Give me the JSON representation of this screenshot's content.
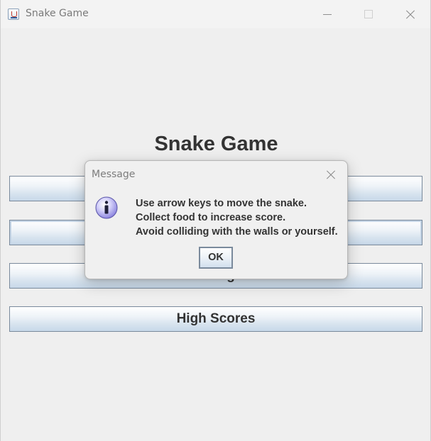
{
  "window": {
    "title": "Snake Game"
  },
  "main": {
    "title": "Snake Game",
    "buttons": [
      {
        "label": ""
      },
      {
        "label": ""
      },
      {
        "label": "Settings"
      },
      {
        "label": "High Scores"
      }
    ]
  },
  "dialog": {
    "title": "Message",
    "lines": [
      "Use arrow keys to move the snake.",
      "Collect food to increase score.",
      "Avoid colliding with the walls or yourself."
    ],
    "ok_label": "OK",
    "icon": "info-icon"
  },
  "colors": {
    "background": "#f0f0f0",
    "button_border": "#7a8a9c",
    "button_gradient_bottom": "#c7d8e9",
    "info_icon": "#b8b3f0"
  }
}
